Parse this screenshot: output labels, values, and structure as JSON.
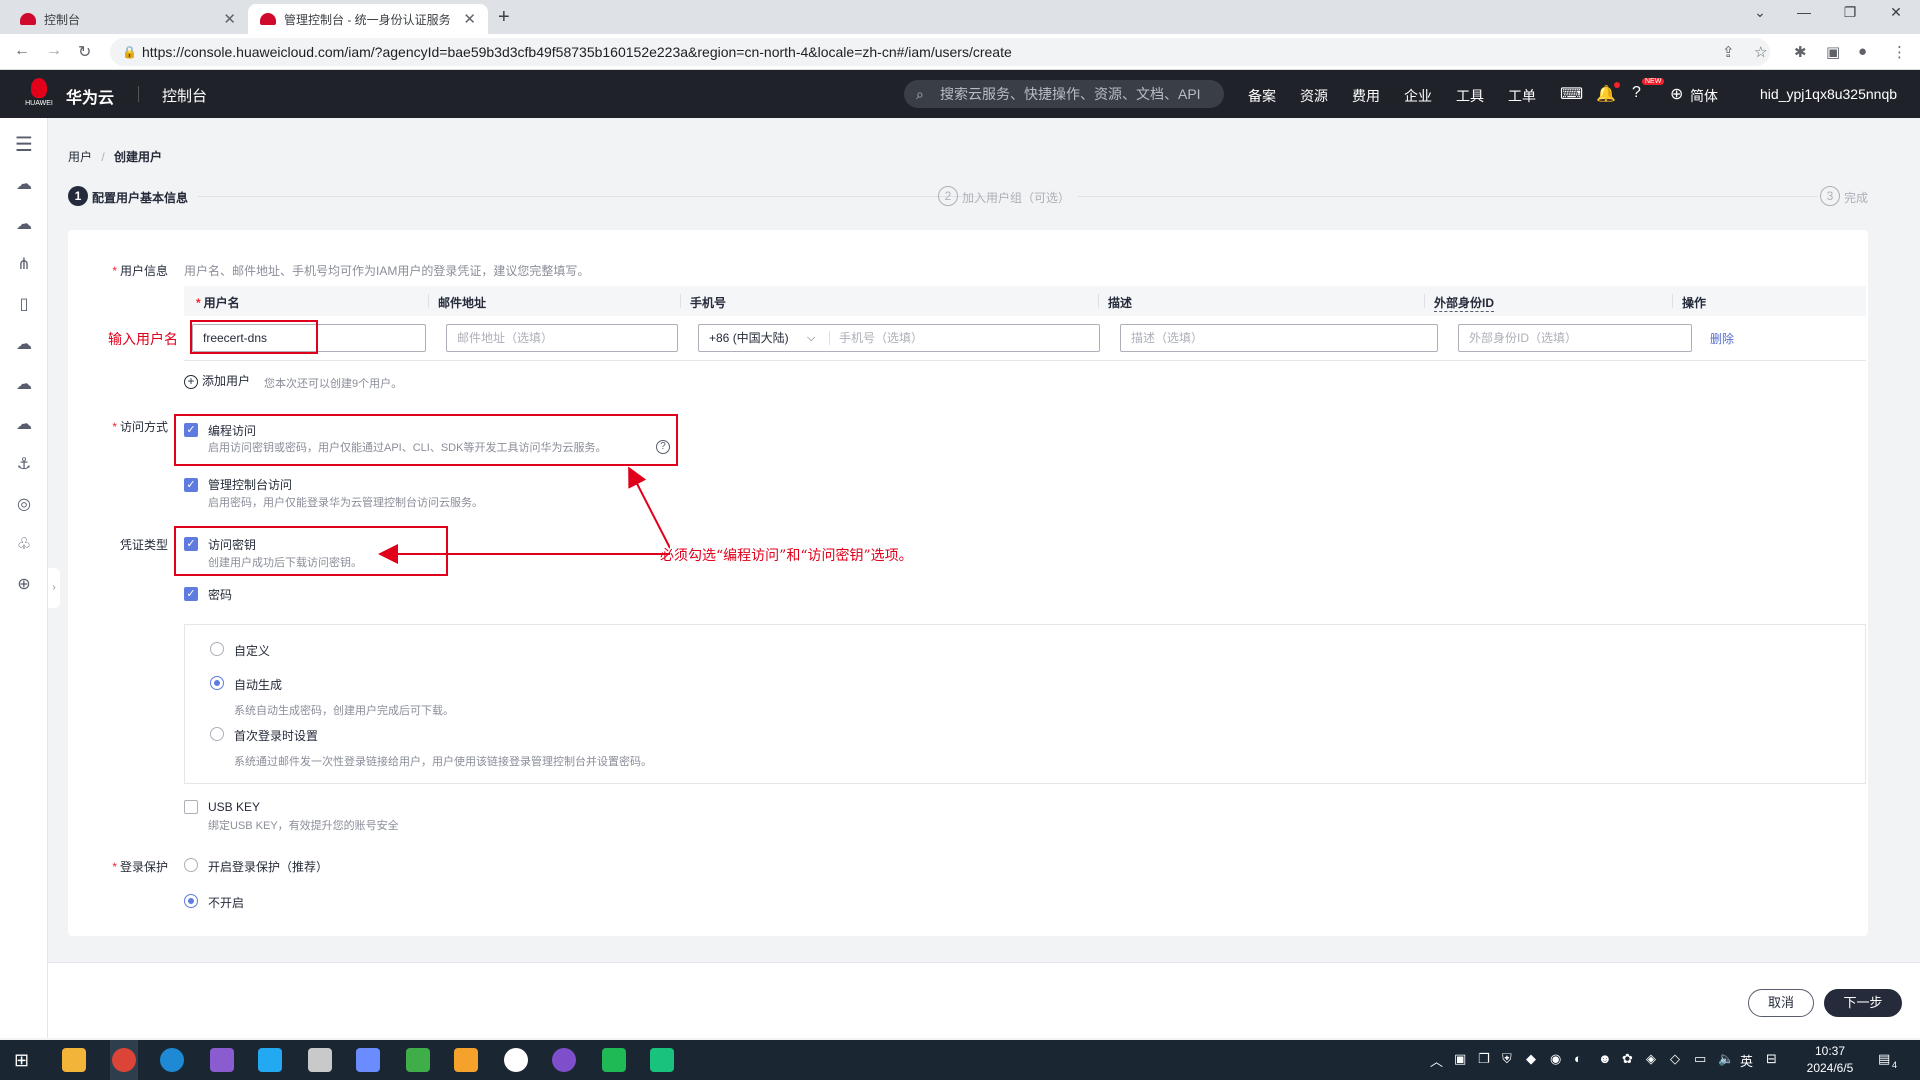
{
  "browser": {
    "tabs": [
      {
        "title": "控制台"
      },
      {
        "title": "管理控制台 - 统一身份认证服务"
      }
    ],
    "new_tab": "+",
    "url": "https://console.huaweicloud.com/iam/?agencyId=bae59b3d3cfb49f58735b160152e223a&region=cn-north-4&locale=zh-cn#/iam/users/create"
  },
  "header": {
    "logo_text": "HUAWEI",
    "brand": "华为云",
    "console": "控制台",
    "search_placeholder": "搜索云服务、快捷操作、资源、文档、API",
    "nav": [
      "备案",
      "资源",
      "费用",
      "企业",
      "工具",
      "工单"
    ],
    "new_badge": "NEW",
    "language": "简体",
    "username": "hid_ypj1qx8u325nnqb"
  },
  "breadcrumb": {
    "parent": "用户",
    "separator": "/",
    "current": "创建用户"
  },
  "steps": [
    {
      "num": "1",
      "label": "配置用户基本信息"
    },
    {
      "num": "2",
      "label": "加入用户组（可选）"
    },
    {
      "num": "3",
      "label": "完成"
    }
  ],
  "user_info": {
    "required": "*",
    "label": "用户信息",
    "hint": "用户名、邮件地址、手机号均可作为IAM用户的登录凭证，建议您完整填写。",
    "columns": [
      "用户名",
      "邮件地址",
      "手机号",
      "描述",
      "外部身份ID",
      "操作"
    ],
    "username_value": "freecert-dns",
    "email_placeholder": "邮件地址（选填）",
    "phone_code": "+86 (中国大陆)",
    "phone_placeholder": "手机号（选填）",
    "desc_placeholder": "描述（选填）",
    "extid_placeholder": "外部身份ID（选填）",
    "delete": "删除",
    "add_user": "添加用户",
    "add_hint": "您本次还可以创建9个用户。"
  },
  "access": {
    "label": "访问方式",
    "programmatic": {
      "title": "编程访问",
      "desc": "启用访问密钥或密码，用户仅能通过API、CLI、SDK等开发工具访问华为云服务。",
      "checked": true
    },
    "console": {
      "title": "管理控制台访问",
      "desc": "启用密码，用户仅能登录华为云管理控制台访问云服务。",
      "checked": true
    }
  },
  "credential": {
    "label": "凭证类型",
    "access_key": {
      "title": "访问密钥",
      "desc": "创建用户成功后下载访问密钥。",
      "checked": true
    },
    "password": {
      "title": "密码",
      "checked": true
    },
    "password_options": [
      {
        "title": "自定义",
        "desc": "",
        "selected": false
      },
      {
        "title": "自动生成",
        "desc": "系统自动生成密码，创建用户完成后可下载。",
        "selected": true
      },
      {
        "title": "首次登录时设置",
        "desc": "系统通过邮件发一次性登录链接给用户，用户使用该链接登录管理控制台并设置密码。",
        "selected": false
      }
    ],
    "usb_key": {
      "title": "USB KEY",
      "desc": "绑定USB KEY，有效提升您的账号安全",
      "checked": false
    }
  },
  "login_protect": {
    "label": "登录保护",
    "options": [
      {
        "title": "开启登录保护（推荐）",
        "selected": false
      },
      {
        "title": "不开启",
        "selected": true
      }
    ]
  },
  "annotations": {
    "username": "输入用户名",
    "access_note": "必须勾选“编程访问”和“访问密钥”选项。",
    "color": "#e0001b"
  },
  "footer": {
    "cancel": "取消",
    "next": "下一步"
  },
  "taskbar": {
    "ime": "英",
    "time": "10:37",
    "date": "2024/6/5",
    "notify_count": "4"
  }
}
